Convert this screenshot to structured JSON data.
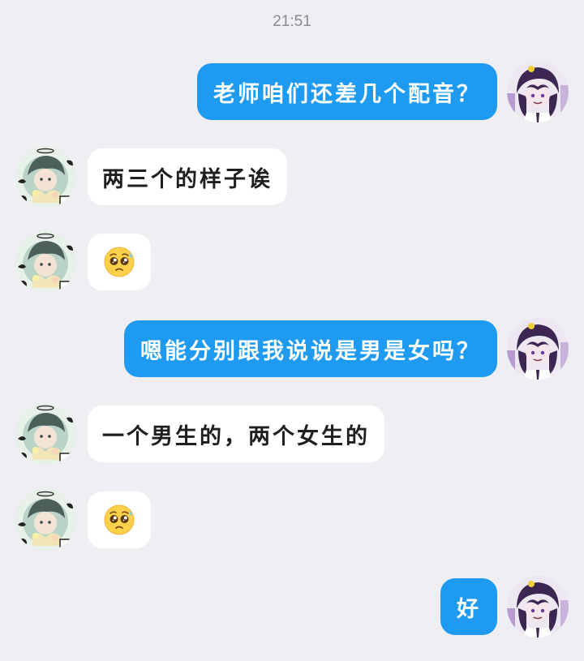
{
  "status": {
    "time": "21:51"
  },
  "messages": [
    {
      "sender": "self",
      "text": "老师咱们还差几个配音？"
    },
    {
      "sender": "other",
      "text": "两三个的样子诶"
    },
    {
      "sender": "other",
      "emoji": "pleading-face"
    },
    {
      "sender": "self",
      "text": "嗯能分别跟我说说是男是女吗？"
    },
    {
      "sender": "other",
      "text": "一个男生的，两个女生的"
    },
    {
      "sender": "other",
      "emoji": "pleading-face"
    },
    {
      "sender": "self",
      "text": "好"
    }
  ],
  "colors": {
    "background": "#efeff3",
    "self_bubble": "#1e9bf0",
    "other_bubble": "#ffffff",
    "timestamp": "#8a8a8e"
  }
}
